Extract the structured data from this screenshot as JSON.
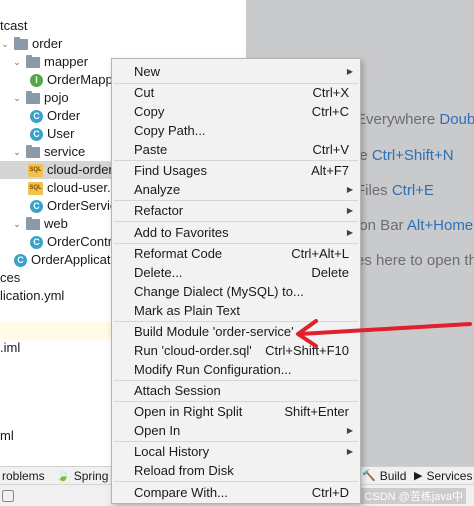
{
  "tree": {
    "rows": [
      {
        "label": "tcast",
        "kind": "text"
      },
      {
        "label": "order",
        "kind": "folder",
        "chev": "⌄"
      },
      {
        "label": "mapper",
        "kind": "folder",
        "chev": "⌄"
      },
      {
        "label": "OrderMapper",
        "kind": "interface"
      },
      {
        "label": "pojo",
        "kind": "folder",
        "chev": "⌄"
      },
      {
        "label": "Order",
        "kind": "class"
      },
      {
        "label": "User",
        "kind": "class"
      },
      {
        "label": "service",
        "kind": "folder",
        "chev": "⌄"
      },
      {
        "label": "cloud-order.sql",
        "kind": "sql"
      },
      {
        "label": "cloud-user.sql",
        "kind": "sql"
      },
      {
        "label": "OrderService",
        "kind": "class"
      },
      {
        "label": "web",
        "kind": "folder",
        "chev": "⌄"
      },
      {
        "label": "OrderController",
        "kind": "class"
      },
      {
        "label": "OrderApplication",
        "kind": "class"
      },
      {
        "label": "ces",
        "kind": "text"
      },
      {
        "label": "lication.yml",
        "kind": "text"
      },
      {
        "label": ".iml",
        "kind": "text"
      },
      {
        "label": "ml",
        "kind": "text"
      }
    ]
  },
  "editor": {
    "hint1": {
      "text": "Everywhere ",
      "key": "Doub"
    },
    "hint2": {
      "text": "le ",
      "key": "Ctrl+Shift+N"
    },
    "hint3": {
      "text": "Files ",
      "key": "Ctrl+E"
    },
    "hint4": {
      "text": "ion Bar ",
      "key": "Alt+Home"
    },
    "hint5": {
      "text": "es here to open th",
      "key": ""
    }
  },
  "context_menu": {
    "items": [
      {
        "label": "New",
        "shortcut": "",
        "submenu": true
      },
      {
        "label": "Cut",
        "shortcut": "Ctrl+X",
        "submenu": false
      },
      {
        "label": "Copy",
        "shortcut": "Ctrl+C",
        "submenu": false
      },
      {
        "label": "Copy Path...",
        "shortcut": "",
        "submenu": false
      },
      {
        "label": "Paste",
        "shortcut": "Ctrl+V",
        "submenu": false
      },
      {
        "label": "Find Usages",
        "shortcut": "Alt+F7",
        "submenu": false
      },
      {
        "label": "Analyze",
        "shortcut": "",
        "submenu": true
      },
      {
        "label": "Refactor",
        "shortcut": "",
        "submenu": true
      },
      {
        "label": "Add to Favorites",
        "shortcut": "",
        "submenu": true
      },
      {
        "label": "Reformat Code",
        "shortcut": "Ctrl+Alt+L",
        "submenu": false
      },
      {
        "label": "Delete...",
        "shortcut": "Delete",
        "submenu": false
      },
      {
        "label": "Change Dialect (MySQL) to...",
        "shortcut": "",
        "submenu": false
      },
      {
        "label": "Mark as Plain Text",
        "shortcut": "",
        "submenu": false
      },
      {
        "label": "Build Module 'order-service'",
        "shortcut": "",
        "submenu": false
      },
      {
        "label": "Run 'cloud-order.sql'",
        "shortcut": "Ctrl+Shift+F10",
        "submenu": false
      },
      {
        "label": "Modify Run Configuration...",
        "shortcut": "",
        "submenu": false
      },
      {
        "label": "Attach Session",
        "shortcut": "",
        "submenu": false
      },
      {
        "label": "Open in Right Split",
        "shortcut": "Shift+Enter",
        "submenu": false
      },
      {
        "label": "Open In",
        "shortcut": "",
        "submenu": true
      },
      {
        "label": "Local History",
        "shortcut": "",
        "submenu": true
      },
      {
        "label": "Reload from Disk",
        "shortcut": "",
        "submenu": false
      },
      {
        "label": "Compare With...",
        "shortcut": "Ctrl+D",
        "submenu": false
      }
    ]
  },
  "bottom_bar": {
    "problems": "roblems",
    "spring": "Spring",
    "build": "Build",
    "services": "Services"
  },
  "watermark": "CSDN @苦练java中",
  "colors": {
    "annotation_arrow": "#e0202a",
    "shortcut_hint": "#2f6fb5"
  }
}
